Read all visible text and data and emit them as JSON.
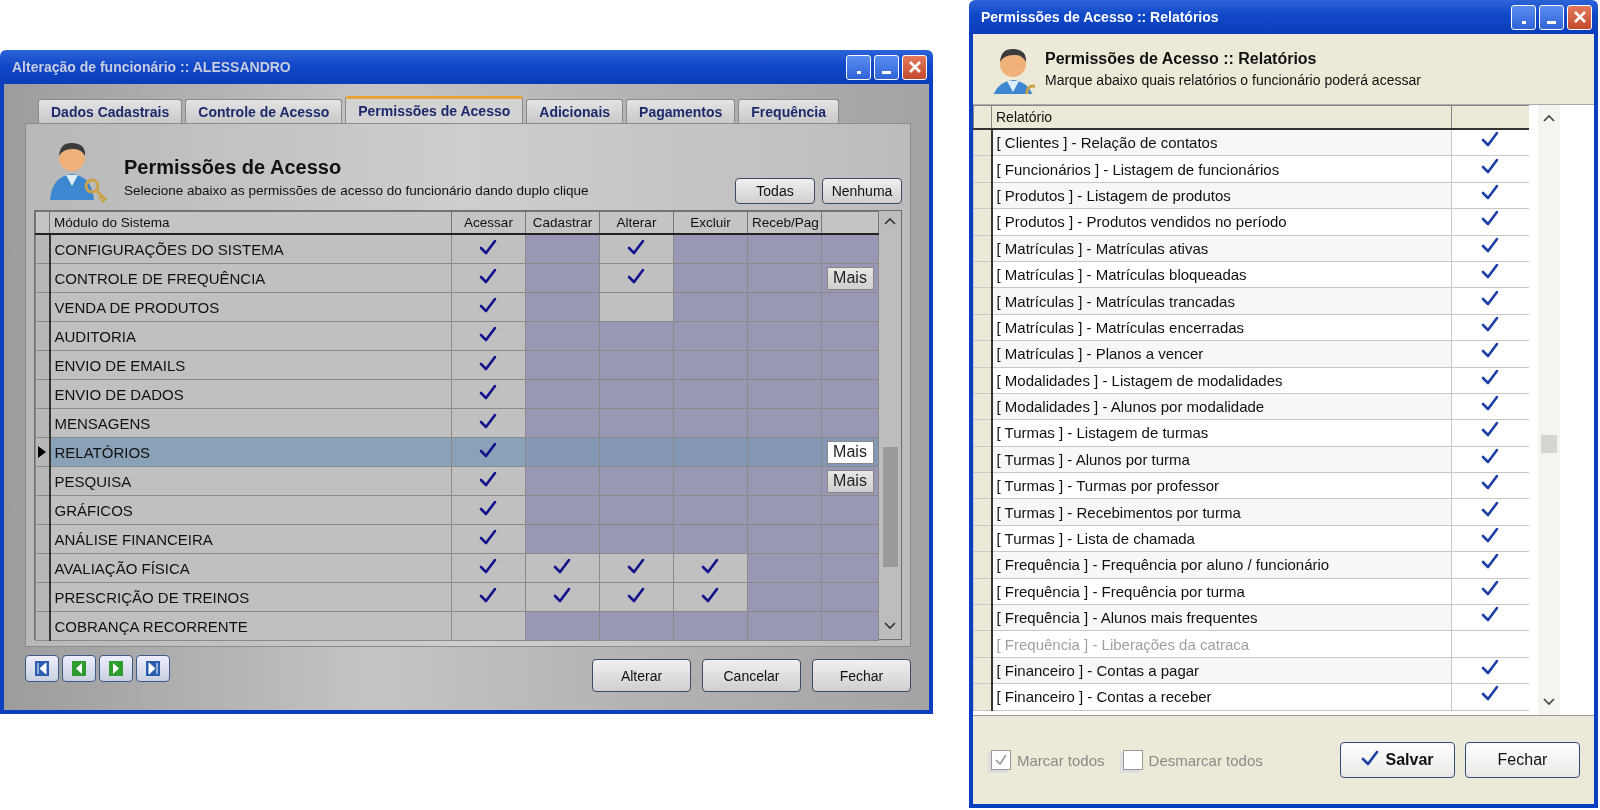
{
  "main_window": {
    "title": "Alteração de funcionário :: ALESSANDRO",
    "tabs": [
      {
        "label": "Dados Cadastrais",
        "selected": false
      },
      {
        "label": "Controle de Acesso",
        "selected": false
      },
      {
        "label": "Permissões de Acesso",
        "selected": true
      },
      {
        "label": "Adicionais",
        "selected": false
      },
      {
        "label": "Pagamentos",
        "selected": false
      },
      {
        "label": "Frequência",
        "selected": false
      }
    ],
    "header": {
      "title": "Permissões de Acesso",
      "subtitle": "Selecione abaixo as permissões de acesso do funcionário dando duplo clique"
    },
    "select_buttons": [
      "Todas",
      "Nenhuma"
    ],
    "grid": {
      "columns": [
        "Módulo do Sistema",
        "Acessar",
        "Cadastrar",
        "Alterar",
        "Excluir",
        "Receb/Pag"
      ],
      "rows": [
        {
          "module": "CONFIGURAÇÕES DO SISTEMA",
          "selected": false,
          "cells": [
            {
              "enabled": true,
              "checked": true
            },
            {
              "enabled": false,
              "checked": false
            },
            {
              "enabled": true,
              "checked": true
            },
            {
              "enabled": false,
              "checked": false
            },
            {
              "enabled": false,
              "checked": false
            }
          ]
        },
        {
          "module": "CONTROLE DE FREQUÊNCIA",
          "selected": false,
          "cells": [
            {
              "enabled": true,
              "checked": true
            },
            {
              "enabled": false,
              "checked": false
            },
            {
              "enabled": true,
              "checked": true
            },
            {
              "enabled": false,
              "checked": false
            },
            {
              "enabled": false,
              "checked": false
            }
          ],
          "more_button": "Mais"
        },
        {
          "module": "VENDA DE PRODUTOS",
          "selected": false,
          "cells": [
            {
              "enabled": true,
              "checked": true
            },
            {
              "enabled": false,
              "checked": false
            },
            {
              "enabled": true,
              "checked": false
            },
            {
              "enabled": false,
              "checked": false
            },
            {
              "enabled": false,
              "checked": false
            }
          ]
        },
        {
          "module": "AUDITORIA",
          "selected": false,
          "cells": [
            {
              "enabled": true,
              "checked": true
            },
            {
              "enabled": false,
              "checked": false
            },
            {
              "enabled": false,
              "checked": false
            },
            {
              "enabled": false,
              "checked": false
            },
            {
              "enabled": false,
              "checked": false
            }
          ]
        },
        {
          "module": "ENVIO DE EMAILS",
          "selected": false,
          "cells": [
            {
              "enabled": true,
              "checked": true
            },
            {
              "enabled": false,
              "checked": false
            },
            {
              "enabled": false,
              "checked": false
            },
            {
              "enabled": false,
              "checked": false
            },
            {
              "enabled": false,
              "checked": false
            }
          ]
        },
        {
          "module": "ENVIO DE DADOS",
          "selected": false,
          "cells": [
            {
              "enabled": true,
              "checked": true
            },
            {
              "enabled": false,
              "checked": false
            },
            {
              "enabled": false,
              "checked": false
            },
            {
              "enabled": false,
              "checked": false
            },
            {
              "enabled": false,
              "checked": false
            }
          ]
        },
        {
          "module": "MENSAGENS",
          "selected": false,
          "cells": [
            {
              "enabled": true,
              "checked": true
            },
            {
              "enabled": false,
              "checked": false
            },
            {
              "enabled": false,
              "checked": false
            },
            {
              "enabled": false,
              "checked": false
            },
            {
              "enabled": false,
              "checked": false
            }
          ]
        },
        {
          "module": "RELATÓRIOS",
          "selected": true,
          "cells": [
            {
              "enabled": true,
              "checked": true
            },
            {
              "enabled": false,
              "checked": false
            },
            {
              "enabled": false,
              "checked": false
            },
            {
              "enabled": false,
              "checked": false
            },
            {
              "enabled": false,
              "checked": false
            }
          ],
          "more_button": "Mais"
        },
        {
          "module": "PESQUISA",
          "selected": false,
          "cells": [
            {
              "enabled": true,
              "checked": true
            },
            {
              "enabled": false,
              "checked": false
            },
            {
              "enabled": false,
              "checked": false
            },
            {
              "enabled": false,
              "checked": false
            },
            {
              "enabled": false,
              "checked": false
            }
          ],
          "more_button": "Mais"
        },
        {
          "module": "GRÁFICOS",
          "selected": false,
          "cells": [
            {
              "enabled": true,
              "checked": true
            },
            {
              "enabled": false,
              "checked": false
            },
            {
              "enabled": false,
              "checked": false
            },
            {
              "enabled": false,
              "checked": false
            },
            {
              "enabled": false,
              "checked": false
            }
          ]
        },
        {
          "module": "ANÁLISE FINANCEIRA",
          "selected": false,
          "cells": [
            {
              "enabled": true,
              "checked": true
            },
            {
              "enabled": false,
              "checked": false
            },
            {
              "enabled": false,
              "checked": false
            },
            {
              "enabled": false,
              "checked": false
            },
            {
              "enabled": false,
              "checked": false
            }
          ]
        },
        {
          "module": "AVALIAÇÃO FÍSICA",
          "selected": false,
          "cells": [
            {
              "enabled": true,
              "checked": true
            },
            {
              "enabled": true,
              "checked": true
            },
            {
              "enabled": true,
              "checked": true
            },
            {
              "enabled": true,
              "checked": true
            },
            {
              "enabled": false,
              "checked": false
            }
          ]
        },
        {
          "module": "PRESCRIÇÃO DE TREINOS",
          "selected": false,
          "cells": [
            {
              "enabled": true,
              "checked": true
            },
            {
              "enabled": true,
              "checked": true
            },
            {
              "enabled": true,
              "checked": true
            },
            {
              "enabled": true,
              "checked": true
            },
            {
              "enabled": false,
              "checked": false
            }
          ]
        },
        {
          "module": "COBRANÇA RECORRENTE",
          "selected": false,
          "cells": [
            {
              "enabled": true,
              "checked": false
            },
            {
              "enabled": false,
              "checked": false
            },
            {
              "enabled": false,
              "checked": false
            },
            {
              "enabled": false,
              "checked": false
            },
            {
              "enabled": false,
              "checked": false
            }
          ]
        }
      ]
    },
    "buttons": [
      "Alterar",
      "Cancelar",
      "Fechar"
    ]
  },
  "report_window": {
    "title": "Permissões de Acesso :: Relatórios",
    "header": {
      "title": "Permissões de Acesso :: Relatórios",
      "subtitle": "Marque abaixo quais relatórios o funcionário poderá acessar"
    },
    "grid": {
      "columns": [
        "Relatório"
      ],
      "rows": [
        {
          "label": "[ Clientes ] - Relação de contatos",
          "enabled": true,
          "checked": true
        },
        {
          "label": "[ Funcionários ] - Listagem de funcionários",
          "enabled": true,
          "checked": true
        },
        {
          "label": "[ Produtos ] - Listagem de produtos",
          "enabled": true,
          "checked": true
        },
        {
          "label": "[ Produtos ] - Produtos vendidos no período",
          "enabled": true,
          "checked": true
        },
        {
          "label": "[ Matrículas ] - Matrículas ativas",
          "enabled": true,
          "checked": true
        },
        {
          "label": "[ Matrículas ] - Matrículas bloqueadas",
          "enabled": true,
          "checked": true
        },
        {
          "label": "[ Matrículas ] - Matrículas trancadas",
          "enabled": true,
          "checked": true
        },
        {
          "label": "[ Matrículas ] - Matrículas encerradas",
          "enabled": true,
          "checked": true
        },
        {
          "label": "[ Matrículas ] - Planos a vencer",
          "enabled": true,
          "checked": true
        },
        {
          "label": "[ Modalidades ] - Listagem de modalidades",
          "enabled": true,
          "checked": true
        },
        {
          "label": "[ Modalidades ] - Alunos por modalidade",
          "enabled": true,
          "checked": true
        },
        {
          "label": "[ Turmas ] - Listagem de turmas",
          "enabled": true,
          "checked": true
        },
        {
          "label": "[ Turmas ] - Alunos por turma",
          "enabled": true,
          "checked": true
        },
        {
          "label": "[ Turmas ] - Turmas por professor",
          "enabled": true,
          "checked": true
        },
        {
          "label": "[ Turmas ] - Recebimentos por turma",
          "enabled": true,
          "checked": true
        },
        {
          "label": "[ Turmas ] - Lista de chamada",
          "enabled": true,
          "checked": true
        },
        {
          "label": "[ Frequência ] - Frequência por aluno / funcionário",
          "enabled": true,
          "checked": true
        },
        {
          "label": "[ Frequência ] - Frequência por turma",
          "enabled": true,
          "checked": true
        },
        {
          "label": "[ Frequência ] - Alunos mais frequentes",
          "enabled": true,
          "checked": true
        },
        {
          "label": "[ Frequência ] - Liberações da catraca",
          "enabled": false,
          "checked": false
        },
        {
          "label": "[ Financeiro ] - Contas a pagar",
          "enabled": true,
          "checked": true
        },
        {
          "label": "[ Financeiro ] - Contas a receber",
          "enabled": true,
          "checked": true
        }
      ]
    },
    "footer_checks": [
      {
        "label": "Marcar todos",
        "checked": true,
        "disabled": true
      },
      {
        "label": "Desmarcar todos",
        "checked": false,
        "disabled": true
      }
    ],
    "buttons": [
      {
        "label": "Salvar",
        "kind": "primary"
      },
      {
        "label": "Fechar",
        "kind": "plain"
      }
    ]
  }
}
